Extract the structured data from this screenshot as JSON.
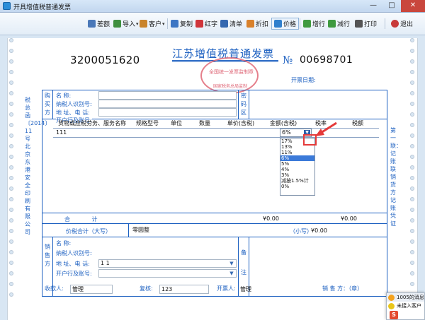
{
  "window": {
    "title": "开具增值税普通发票",
    "min": "—",
    "max": "□",
    "close": "✕"
  },
  "toolbar": {
    "items": [
      {
        "label": "差额",
        "icon": "difference-icon",
        "color": "#4a78b8"
      },
      {
        "label": "导入",
        "icon": "import-icon",
        "color": "#3f8f3f",
        "caret": "▾"
      },
      {
        "label": "客户",
        "icon": "customer-icon",
        "color": "#c9832a",
        "caret": "▾"
      },
      {
        "label": "复制",
        "icon": "copy-icon",
        "color": "#3d76c4"
      },
      {
        "label": "红字",
        "icon": "red-invoice-icon",
        "color": "#d0353a"
      },
      {
        "label": "清单",
        "icon": "list-icon",
        "color": "#3468b0"
      },
      {
        "label": "折扣",
        "icon": "discount-icon",
        "color": "#d9812b"
      },
      {
        "label": "价格",
        "icon": "price-icon",
        "color": "#2f7fcd"
      },
      {
        "label": "增行",
        "icon": "add-row-icon",
        "color": "#3f9a3f"
      },
      {
        "label": "减行",
        "icon": "delete-row-icon",
        "color": "#3f9a3f"
      },
      {
        "label": "打印",
        "icon": "print-icon",
        "color": "#555555"
      },
      {
        "label": "退出",
        "icon": "exit-icon",
        "color": "#c83a3a"
      }
    ]
  },
  "invoice": {
    "code": "3200051620",
    "title": "江苏增值税普通发票",
    "seal_line1": "全国统一发票监制章",
    "seal_line2": "国家税务总局监制",
    "number_sign": "№",
    "number": "00698701",
    "issue_date_label": "开票日期:",
    "side_left": "税总函〔2014〕11号北京东港安全印刷有限公司",
    "side_right": "第一联：记账联 销货方记账凭证",
    "buyer": {
      "section_label": "购买方",
      "name_label": "名 称:",
      "taxid_label": "纳税人识别号:",
      "address_label": "地 址、电 话:",
      "bank_label": "开户行及账号:",
      "name_value": "",
      "taxid_value": "",
      "address_value": "",
      "bank_value": ""
    },
    "cipher_label": "密码区",
    "columns": [
      "货物或应税劳务、服务名称",
      "规格型号",
      "单位",
      "数量",
      "单价(含税)",
      "金额(含税)",
      "税率",
      "税额"
    ],
    "row": {
      "name": "111",
      "rate": "6%"
    },
    "rate_options": [
      "17%",
      "13%",
      "11%",
      "6%",
      "5%",
      "4%",
      "3%",
      "减按1.5%计",
      "0%"
    ],
    "rate_selected": "6%",
    "total_label": "合 计",
    "total_amount": "¥0.00",
    "total_tax": "¥0.00",
    "sum_label": "价税合计（大写）",
    "sum_upper": "零圆整",
    "sum_lower_label": "（小写）",
    "sum_lower": "¥0.00",
    "seller": {
      "section_label": "销售方",
      "name_label": "名 称:",
      "taxid_label": "纳税人识别号:",
      "address_label": "地 址、电 话:",
      "bank_label": "开户行及账号:",
      "address_value": "1 1"
    },
    "remark_label": "备注",
    "payee_label": "收款人:",
    "payee_value": "管理",
    "reviewer_label": "复核:",
    "reviewer_value": "123",
    "drawer_label": "开票人:",
    "drawer_value": "管理",
    "seller_sign_label": "销 售 方：（章）"
  },
  "notification": {
    "line1": "1005的消息",
    "line2": "未接入客户",
    "logo": "S"
  }
}
